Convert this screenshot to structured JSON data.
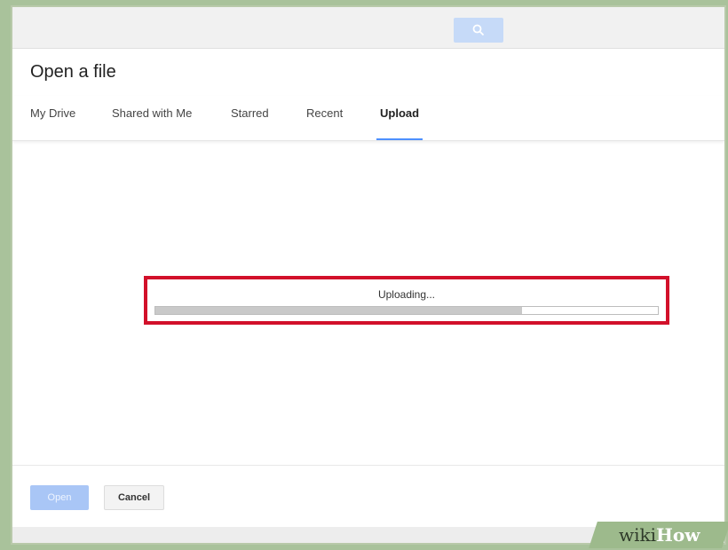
{
  "dialog": {
    "title": "Open a file",
    "tabs": [
      {
        "label": "My Drive"
      },
      {
        "label": "Shared with Me"
      },
      {
        "label": "Starred"
      },
      {
        "label": "Recent"
      },
      {
        "label": "Upload",
        "active": true
      }
    ]
  },
  "search": {
    "icon": "search-icon"
  },
  "upload": {
    "status_text": "Uploading...",
    "progress_fraction": 0.73,
    "highlight_color": "#d2102a"
  },
  "footer": {
    "open_label": "Open",
    "cancel_label": "Cancel"
  },
  "watermark": {
    "wiki": "wiki",
    "how": "How"
  },
  "colors": {
    "accent": "#4d90fe",
    "open_button": "#a9c6f6"
  }
}
